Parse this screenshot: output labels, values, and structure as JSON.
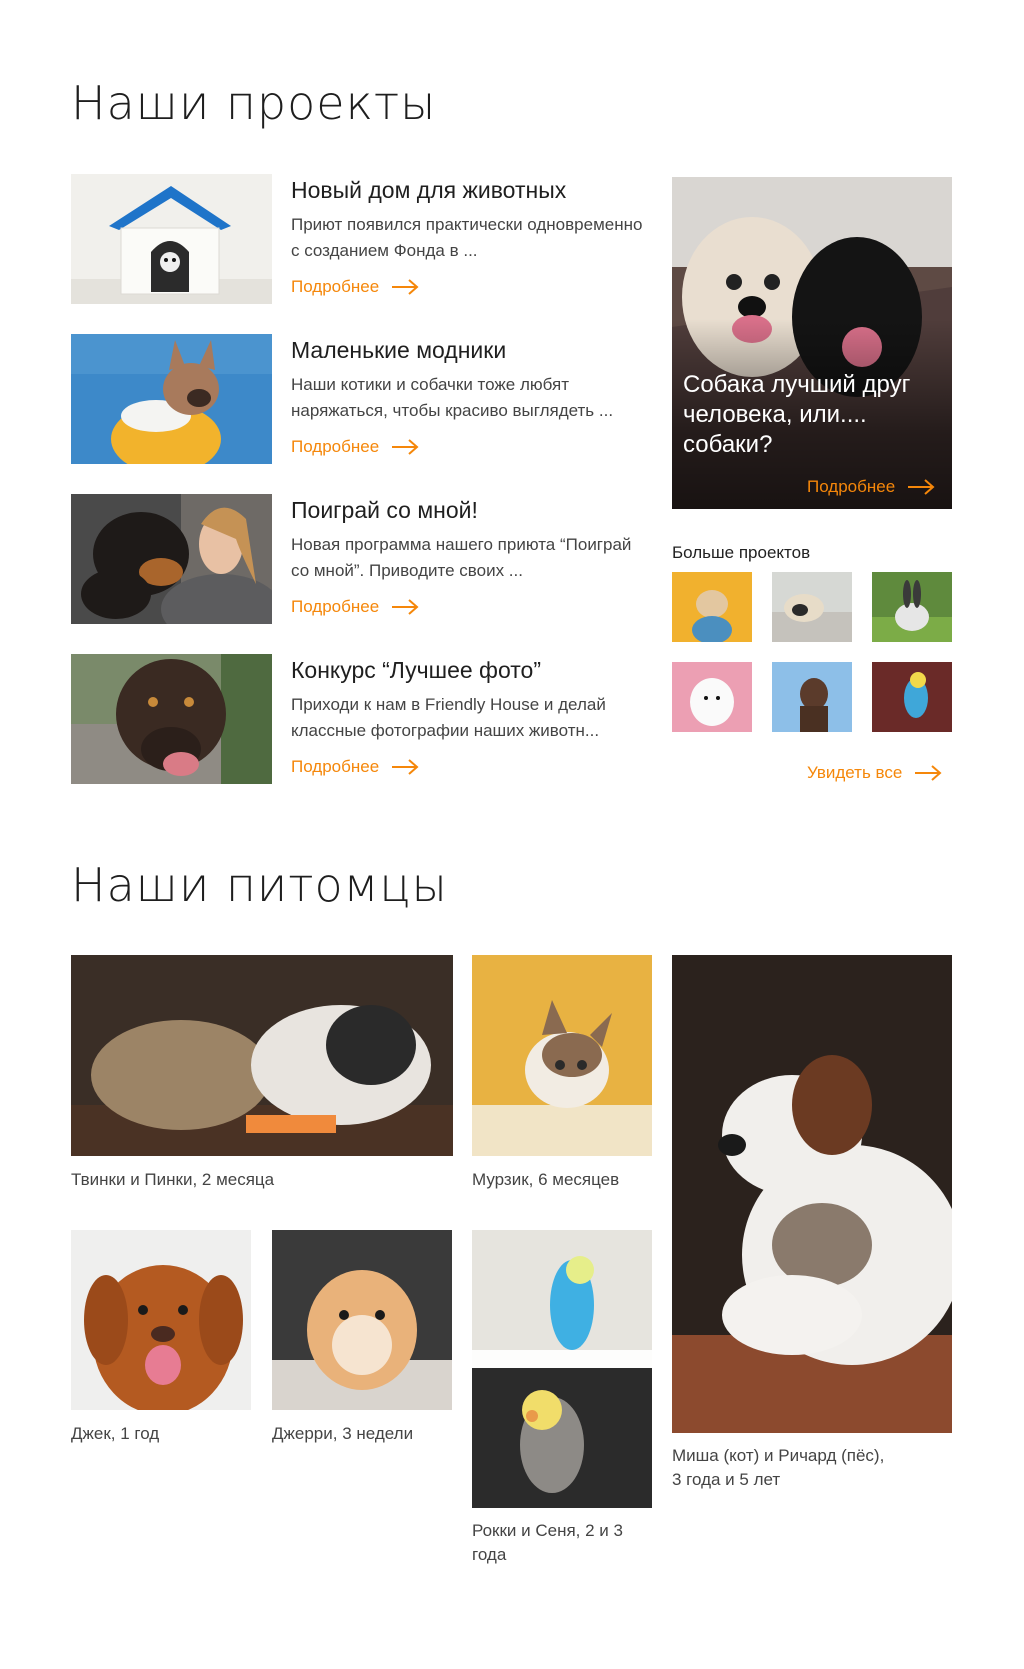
{
  "projects_section": {
    "title": "Наши проекты",
    "more_label": "Подробнее",
    "items": [
      {
        "title": "Новый дом для животных",
        "desc": "Приют появился практически одновременно с созданием Фонда в ...",
        "image": "dog-in-kennel-photo"
      },
      {
        "title": "Маленькие модники",
        "desc": "Наши котики и собачки тоже любят наряжаться, чтобы красиво выглядеть ...",
        "image": "bulldog-in-hoodie-photo"
      },
      {
        "title": "Поиграй со мной!",
        "desc": "Новая программа нашего приюта “Поиграй со мной”. Приводите своих ...",
        "image": "girl-with-dog-photo"
      },
      {
        "title": "Конкурс “Лучшее фото”",
        "desc": "Приходи к нам в Friendly House и делай классные фотографии наших животн...",
        "image": "dog-licking-photo"
      }
    ],
    "feature": {
      "title": "Собака лучший друг человека, или.... собаки?",
      "more_label": "Подробнее",
      "image": "two-dogs-photo"
    },
    "more_projects": {
      "title": "Больше проектов",
      "thumbs": [
        "dog-in-shirt",
        "pug-in-bed",
        "rabbit",
        "samoyed",
        "brown-dog",
        "parrot"
      ],
      "see_all_label": "Увидеть все"
    }
  },
  "pets_section": {
    "title": "Наши питомцы",
    "pets": [
      {
        "caption": "Твинки и Пинки, 2 месяца",
        "image": "guinea-pigs-photo"
      },
      {
        "caption": "Мурзик, 6 месяцев",
        "image": "kitten-photo"
      },
      {
        "caption": "Джек, 1 год",
        "image": "red-dog-photo"
      },
      {
        "caption": "Джерри, 3 недели",
        "image": "hamster-photo"
      },
      {
        "caption": "Рокки и Сеня, 2 и 3 года",
        "image": "parrots-photo"
      },
      {
        "caption_line1": "Миша (кот) и Ричард (пёс),",
        "caption_line2": "3 года и 5 лет",
        "image": "dog-and-cat-photo"
      }
    ]
  },
  "colors": {
    "accent": "#f5870a",
    "text": "#222222",
    "muted": "#444444"
  }
}
